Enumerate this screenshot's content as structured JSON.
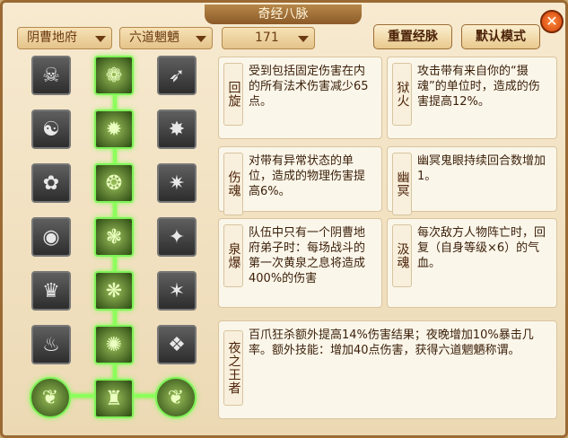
{
  "window": {
    "title": "奇经八脉",
    "close": "✕"
  },
  "filters": {
    "school": "阴曹地府",
    "path": "六道魍魉",
    "level": "171"
  },
  "buttons": {
    "reset": "重置经脉",
    "default": "默认模式"
  },
  "grid": {
    "left": [
      "☠",
      "☯",
      "✿",
      "◉",
      "♛",
      "♨"
    ],
    "middle": [
      "❁",
      "✹",
      "❂",
      "❃",
      "❋",
      "✺",
      "♜"
    ],
    "right": [
      "➶",
      "✸",
      "✷",
      "✦",
      "✶",
      "❖"
    ],
    "bottom_left": "❦",
    "bottom_right": "❦"
  },
  "skills": [
    {
      "name": "回旋",
      "text": "受到包括固定伤害在内的所有法术伤害减少65点。"
    },
    {
      "name": "狱火",
      "text": "攻击带有来自你的“摄魂”的单位时，造成的伤害提高12%。"
    },
    {
      "name": "伤魂",
      "text": "对带有异常状态的单位，造成的物理伤害提高6%。"
    },
    {
      "name": "幽冥",
      "text": "幽冥鬼眼持续回合数增加1。"
    },
    {
      "name": "泉爆",
      "text": "队伍中只有一个阴曹地府弟子时：每场战斗的第一次黄泉之息将造成400%的伤害"
    },
    {
      "name": "汲魂",
      "text": "每次敌方人物阵亡时，回复（自身等级×6）的气血。"
    },
    {
      "name": "夜之王者",
      "text": "百爪狂杀额外提高14%伤害结果；夜晚增加10%暴击几率。额外技能：增加40点伤害，获得六道魍魉称谓。"
    }
  ]
}
